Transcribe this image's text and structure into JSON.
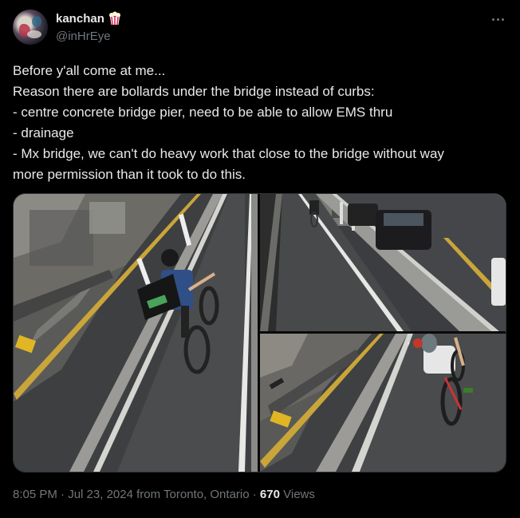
{
  "author": {
    "display_name": "kanchan",
    "handle": "@inHrEye",
    "avatar_icon": "avatar-image",
    "name_emoji_icon": "popcorn-icon"
  },
  "menu_icon": "more-options-icon",
  "tweet_text": [
    "Before y'all come at me...",
    "Reason there are bollards under the bridge instead of curbs:",
    "- centre concrete bridge pier, need to be able to allow EMS thru",
    "- drainage",
    "- Mx bridge, we can't do heavy work that close to the bridge without way",
    "more permission than it took to do this."
  ],
  "media": [
    {
      "description_icon": "photo-cyclist-delivery-bag"
    },
    {
      "description_icon": "photo-bike-lane-cars"
    },
    {
      "description_icon": "photo-cyclist-bollards"
    }
  ],
  "meta": {
    "time": "8:05 PM",
    "separator": "·",
    "date": "Jul 23, 2024",
    "location": "from Toronto, Ontario",
    "views_count": "670",
    "views_label": "Views"
  },
  "colors": {
    "background": "#000000",
    "text_primary": "#e7e9ea",
    "text_secondary": "#71767b",
    "border": "#2f3336"
  }
}
